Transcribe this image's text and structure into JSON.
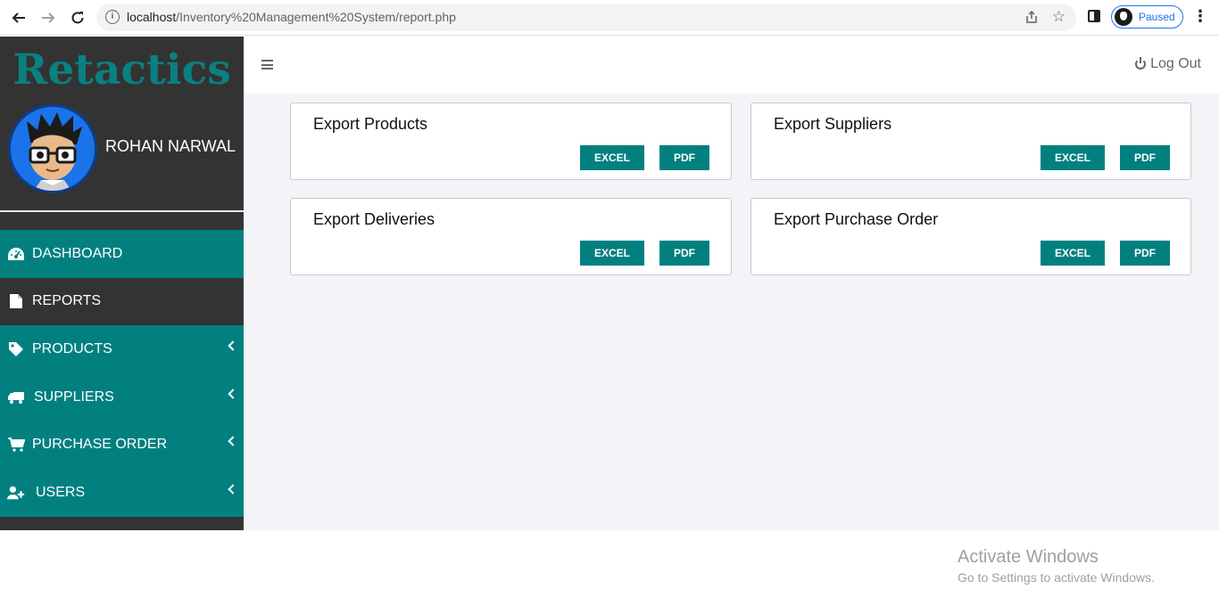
{
  "browser": {
    "url_host": "localhost",
    "url_path": "/Inventory%20Management%20System/report.php",
    "profile_status": "Paused"
  },
  "sidebar": {
    "brand": "Retactics",
    "user_name": "ROHAN NARWAL",
    "items": [
      {
        "label": "DASHBOARD",
        "icon": "dashboard-gauge-icon",
        "active": false,
        "has_submenu": false
      },
      {
        "label": "REPORTS",
        "icon": "file-icon",
        "active": true,
        "has_submenu": false
      },
      {
        "label": "PRODUCTS",
        "icon": "tag-icon",
        "active": false,
        "has_submenu": true
      },
      {
        "label": "SUPPLIERS",
        "icon": "truck-icon",
        "active": false,
        "has_submenu": true
      },
      {
        "label": "PURCHASE ORDER",
        "icon": "cart-icon",
        "active": false,
        "has_submenu": true
      },
      {
        "label": "USERS",
        "icon": "user-plus-icon",
        "active": false,
        "has_submenu": true
      }
    ]
  },
  "header": {
    "logout_label": "Log Out"
  },
  "cards": [
    {
      "title": "Export Products",
      "excel_label": "EXCEL",
      "pdf_label": "PDF"
    },
    {
      "title": "Export Suppliers",
      "excel_label": "EXCEL",
      "pdf_label": "PDF"
    },
    {
      "title": "Export Deliveries",
      "excel_label": "EXCEL",
      "pdf_label": "PDF"
    },
    {
      "title": "Export Purchase Order",
      "excel_label": "EXCEL",
      "pdf_label": "PDF"
    }
  ],
  "watermark": {
    "title": "Activate Windows",
    "subtitle": "Go to Settings to activate Windows."
  },
  "colors": {
    "accent": "#028080",
    "brand_text": "#0a8080",
    "sidebar_bg": "#333333",
    "content_bg": "#f3f4f8"
  }
}
